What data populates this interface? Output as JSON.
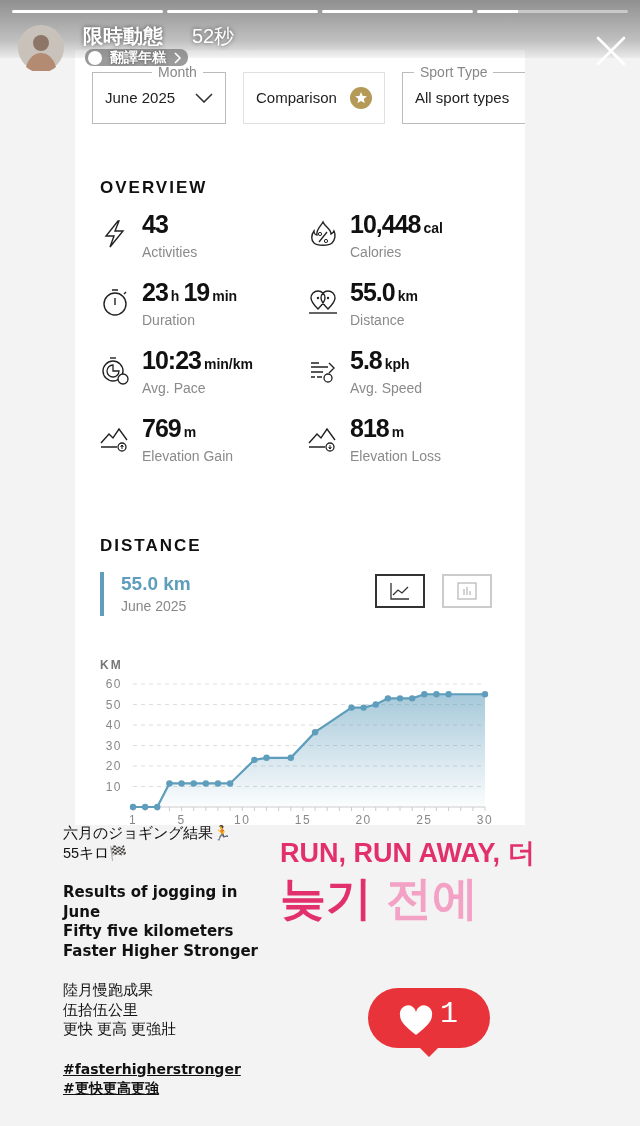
{
  "story": {
    "progress": [
      {
        "level": 1
      },
      {
        "level": 1
      },
      {
        "level": 1
      },
      {
        "level": 0.27
      }
    ],
    "title": "限時動態",
    "time": "52秒",
    "subtitle": "翻譯年糕"
  },
  "filters": [
    {
      "kind": "dropdown",
      "label": "Month",
      "value": "June 2025",
      "chevron": true
    },
    {
      "kind": "button",
      "value": "Comparison"
    },
    {
      "kind": "dropdown",
      "label": "Sport Type",
      "value": "All sport types",
      "chevron": false
    }
  ],
  "overview": {
    "title": "OVERVIEW",
    "stats": [
      {
        "parts": [
          {
            "text": "43",
            "kind": "number"
          }
        ],
        "label": "Activities"
      },
      {
        "parts": [
          {
            "text": "10,448",
            "kind": "number"
          },
          {
            "text": "cal",
            "kind": "unit"
          }
        ],
        "label": "Calories"
      },
      {
        "parts": [
          {
            "text": "23",
            "kind": "number"
          },
          {
            "text": "h",
            "kind": "unit"
          },
          {
            "text": "19",
            "kind": "number"
          },
          {
            "text": "min",
            "kind": "unit"
          }
        ],
        "label": "Duration"
      },
      {
        "parts": [
          {
            "text": "55.0",
            "kind": "number"
          },
          {
            "text": "km",
            "kind": "unit"
          }
        ],
        "label": "Distance"
      },
      {
        "parts": [
          {
            "text": "10:23",
            "kind": "number"
          },
          {
            "text": "min/km",
            "kind": "unit"
          }
        ],
        "label": "Avg. Pace"
      },
      {
        "parts": [
          {
            "text": "5.8",
            "kind": "number"
          },
          {
            "text": "kph",
            "kind": "unit"
          }
        ],
        "label": "Avg. Speed"
      },
      {
        "parts": [
          {
            "text": "769",
            "kind": "number"
          },
          {
            "text": "m",
            "kind": "unit"
          }
        ],
        "label": "Elevation Gain"
      },
      {
        "parts": [
          {
            "text": "818",
            "kind": "number"
          },
          {
            "text": "m",
            "kind": "unit"
          }
        ],
        "label": "Elevation Loss"
      }
    ]
  },
  "distance": {
    "title": "DISTANCE",
    "total": "55.0 km",
    "period": "June 2025",
    "views": [
      {
        "selected": true
      },
      {
        "selected": false
      }
    ],
    "chart_data": {
      "type": "area",
      "ylabel": "KM",
      "x": [
        1,
        2,
        3,
        4,
        5,
        6,
        7,
        8,
        9,
        11,
        12,
        14,
        16,
        19,
        20,
        21,
        22,
        23,
        24,
        25,
        26,
        27,
        30
      ],
      "values": [
        0,
        0,
        0,
        11.5,
        11.5,
        11.5,
        11.5,
        11.5,
        11.5,
        23,
        24,
        24,
        36.5,
        48.5,
        48.5,
        50,
        53,
        53,
        53,
        55,
        55,
        55,
        55
      ],
      "xlim": [
        1,
        30
      ],
      "ylim": [
        0,
        60
      ],
      "grid": true,
      "xticks": [
        1,
        5,
        10,
        15,
        20,
        25,
        30
      ],
      "yticks": [
        10,
        20,
        30,
        40,
        50,
        60
      ]
    }
  },
  "caption": {
    "blocks": [
      {
        "kind": "text",
        "lines": [
          "六月のジョギング結果🏃",
          "55キロ🏁"
        ]
      },
      {
        "kind": "bold",
        "lines": [
          "Results of jogging in June",
          "Fifty five kilometers",
          "Faster Higher Stronger"
        ]
      },
      {
        "kind": "text",
        "lines": [
          "陸月慢跑成果",
          "伍拾伍公里",
          "更快 更高 更強壯"
        ]
      },
      {
        "kind": "hashtags",
        "lines": [
          "#fasterhigherstronger",
          "#更快更高更強"
        ]
      }
    ]
  },
  "sticker": {
    "lines": [
      {
        "segments": [
          {
            "text": "RUN, RUN AWAY, 더",
            "color": "#e2306c"
          }
        ]
      },
      {
        "segments": [
          {
            "text": "늦기",
            "color": "#e2306c"
          },
          {
            "text": "전에",
            "color": "#f3a1c4"
          }
        ]
      }
    ]
  },
  "like": {
    "count": "1"
  }
}
